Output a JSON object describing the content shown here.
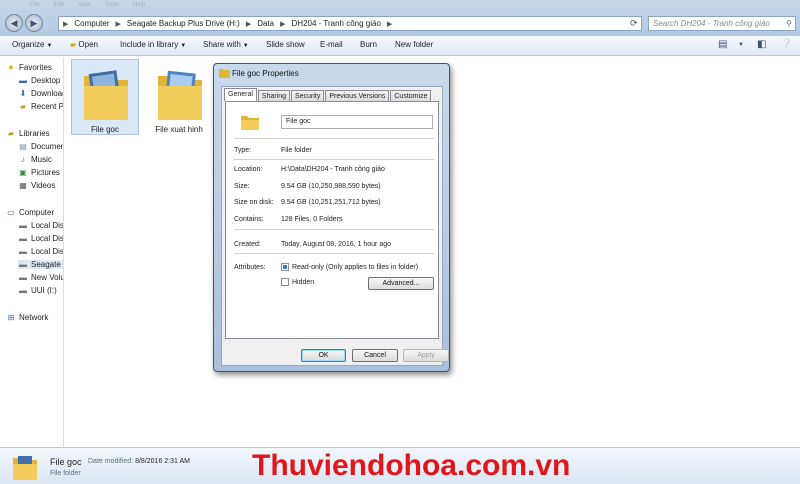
{
  "menu_ghost": [
    "File",
    "Edit",
    "View",
    "Tools",
    "Help"
  ],
  "address": {
    "crumbs": [
      "Computer",
      "Seagate Backup Plus Drive (H:)",
      "Data",
      "DH204 - Tranh công giáo"
    ]
  },
  "search": {
    "placeholder": "Search DH204 - Tranh công giáo"
  },
  "toolbar": {
    "organize": "Organize",
    "open": "Open",
    "include": "Include in library",
    "share": "Share with",
    "slideshow": "Slide show",
    "email": "E-mail",
    "burn": "Burn",
    "newfolder": "New folder"
  },
  "nav": {
    "favorites": "Favorites",
    "desktop": "Desktop",
    "downloads": "Downloads",
    "recent": "Recent Places",
    "libraries": "Libraries",
    "documents": "Documents",
    "music": "Music",
    "pictures": "Pictures",
    "videos": "Videos",
    "computer": "Computer",
    "local1": "Local Disk",
    "local2": "Local Disk",
    "local3": "Local Disk",
    "seagate": "Seagate",
    "newvol": "New Volume",
    "uui": "UUI (I:)",
    "network": "Network"
  },
  "files": [
    {
      "name": "File goc"
    },
    {
      "name": "File xuat hinh"
    }
  ],
  "status": {
    "name": "File goc",
    "modified_label": "Date modified:",
    "modified_value": "8/8/2016 2:31 AM",
    "type": "File folder"
  },
  "watermark": "Thuviendohoa.com.vn",
  "dialog": {
    "title": "File goc Properties",
    "tabs": [
      "General",
      "Sharing",
      "Security",
      "Previous Versions",
      "Customize"
    ],
    "name_value": "File goc",
    "type_label": "Type:",
    "type_value": "File folder",
    "location_label": "Location:",
    "location_value": "H:\\Data\\DH204 - Tranh công giáo",
    "size_label": "Size:",
    "size_value": "9.54 GB (10,250,988,590 bytes)",
    "sizeondisk_label": "Size on disk:",
    "sizeondisk_value": "9.54 GB (10,251,251,712 bytes)",
    "contains_label": "Contains:",
    "contains_value": "128 Files, 0 Folders",
    "created_label": "Created:",
    "created_value": "Today, August 08, 2016, 1 hour ago",
    "attributes_label": "Attributes:",
    "readonly_label": "Read-only (Only applies to files in folder)",
    "hidden_label": "Hidden",
    "advanced_button": "Advanced...",
    "ok_button": "OK",
    "cancel_button": "Cancel",
    "apply_button": "Apply"
  },
  "colors": {
    "watermark": "#e0161b",
    "selection": "#dbe8f7"
  }
}
